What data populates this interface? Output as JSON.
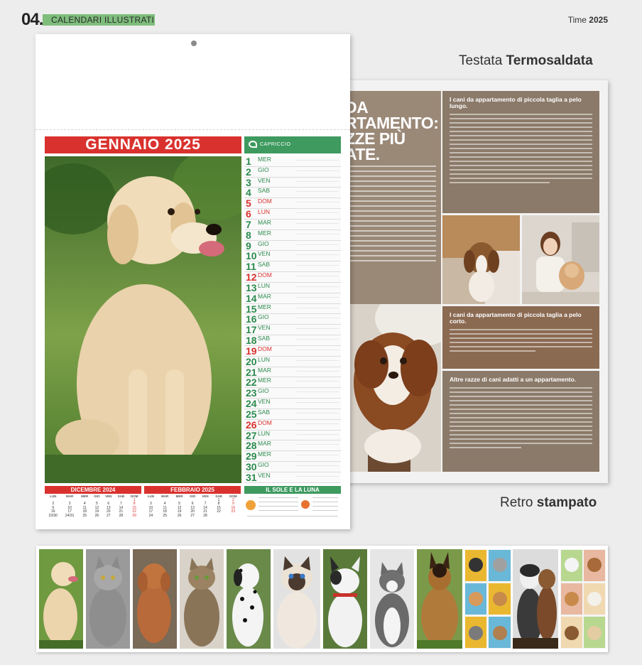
{
  "header": {
    "number": "04.",
    "section": "CALENDARI ILLUSTRATI",
    "time_label": "Time",
    "time_year": "2025"
  },
  "captions": {
    "top_light": "Testata",
    "top_bold": "Termosaldata",
    "bottom_light": "Retro",
    "bottom_bold": "stampato"
  },
  "front": {
    "month_title": "GENNAIO 2025",
    "brand": "CAPRICCIO",
    "days": [
      {
        "n": "1",
        "d": "MER",
        "sun": false
      },
      {
        "n": "2",
        "d": "GIO",
        "sun": false
      },
      {
        "n": "3",
        "d": "VEN",
        "sun": false
      },
      {
        "n": "4",
        "d": "SAB",
        "sun": false
      },
      {
        "n": "5",
        "d": "DOM",
        "sun": true
      },
      {
        "n": "6",
        "d": "LUN",
        "sun": true
      },
      {
        "n": "7",
        "d": "MAR",
        "sun": false
      },
      {
        "n": "8",
        "d": "MER",
        "sun": false
      },
      {
        "n": "9",
        "d": "GIO",
        "sun": false
      },
      {
        "n": "10",
        "d": "VEN",
        "sun": false
      },
      {
        "n": "11",
        "d": "SAB",
        "sun": false
      },
      {
        "n": "12",
        "d": "DOM",
        "sun": true
      },
      {
        "n": "13",
        "d": "LUN",
        "sun": false
      },
      {
        "n": "14",
        "d": "MAR",
        "sun": false
      },
      {
        "n": "15",
        "d": "MER",
        "sun": false
      },
      {
        "n": "16",
        "d": "GIO",
        "sun": false
      },
      {
        "n": "17",
        "d": "VEN",
        "sun": false
      },
      {
        "n": "18",
        "d": "SAB",
        "sun": false
      },
      {
        "n": "19",
        "d": "DOM",
        "sun": true
      },
      {
        "n": "20",
        "d": "LUN",
        "sun": false
      },
      {
        "n": "21",
        "d": "MAR",
        "sun": false
      },
      {
        "n": "22",
        "d": "MER",
        "sun": false
      },
      {
        "n": "23",
        "d": "GIO",
        "sun": false
      },
      {
        "n": "24",
        "d": "VEN",
        "sun": false
      },
      {
        "n": "25",
        "d": "SAB",
        "sun": false
      },
      {
        "n": "26",
        "d": "DOM",
        "sun": true
      },
      {
        "n": "27",
        "d": "LUN",
        "sun": false
      },
      {
        "n": "28",
        "d": "MAR",
        "sun": false
      },
      {
        "n": "29",
        "d": "MER",
        "sun": false
      },
      {
        "n": "30",
        "d": "GIO",
        "sun": false
      },
      {
        "n": "31",
        "d": "VEN",
        "sun": false
      }
    ],
    "prev_month": {
      "title": "DICEMBRE 2024",
      "weekdays": [
        "LUN",
        "MAR",
        "MER",
        "GIO",
        "VEN",
        "SAB",
        "DOM"
      ],
      "rows": [
        [
          "",
          "",
          "",
          "",
          "",
          "",
          "1"
        ],
        [
          "2",
          "3",
          "4",
          "5",
          "6",
          "7",
          "8"
        ],
        [
          "9",
          "10",
          "11",
          "12",
          "13",
          "14",
          "15"
        ],
        [
          "16",
          "17",
          "18",
          "19",
          "20",
          "21",
          "22"
        ],
        [
          "23/30",
          "24/31",
          "25",
          "26",
          "27",
          "28",
          "29"
        ]
      ]
    },
    "next_month": {
      "title": "FEBBRAIO 2025",
      "weekdays": [
        "LUN",
        "MAR",
        "MER",
        "GIO",
        "VEN",
        "SAB",
        "DOM"
      ],
      "rows": [
        [
          "",
          "",
          "",
          "",
          "",
          "1",
          "2"
        ],
        [
          "3",
          "4",
          "5",
          "6",
          "7",
          "8",
          "9"
        ],
        [
          "10",
          "11",
          "12",
          "13",
          "14",
          "15",
          "16"
        ],
        [
          "17",
          "18",
          "19",
          "20",
          "21",
          "22",
          "23"
        ],
        [
          "24",
          "25",
          "26",
          "27",
          "28",
          "",
          ""
        ]
      ]
    },
    "sun_moon_title": "IL SOLE E LA LUNA"
  },
  "back": {
    "headline": [
      "DA",
      "RTAMENTO:",
      "ZZE PIÙ",
      "ATE."
    ],
    "box1_title": "I cani da appartamento di piccola taglia a pelo lungo.",
    "box2_title": "I cani da appartamento di piccola taglia a pelo corto.",
    "box3_title": "Altre razze di cani adatti a un appartamento."
  },
  "colors": {
    "red": "#d9322e",
    "green": "#3e9a5f",
    "header_green": "#7fbd7c",
    "brown": "#8b7a69"
  }
}
